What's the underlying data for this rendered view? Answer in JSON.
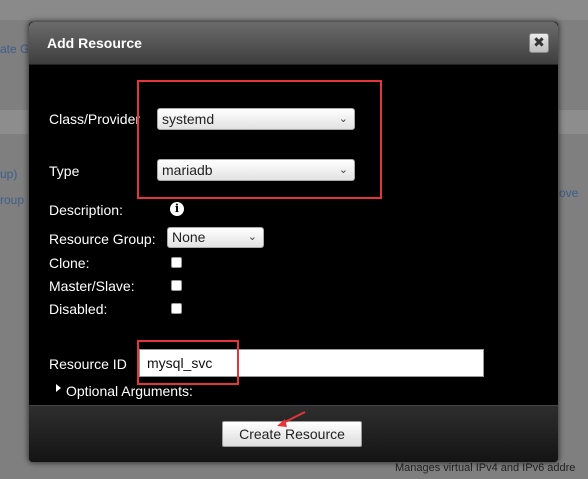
{
  "background": {
    "left_fragments": [
      "ate G",
      "up)",
      "roup"
    ],
    "right_fragment": "ove",
    "bottom_right_text": "Manages virtual IPv4 and IPv6 addre"
  },
  "dialog": {
    "title": "Add Resource",
    "close_glyph": "✖",
    "class_provider": {
      "label": "Class/Provider",
      "value": "systemd"
    },
    "type": {
      "label": "Type",
      "value": "mariadb"
    },
    "description": {
      "label": "Description:",
      "icon": "info-icon"
    },
    "resource_group": {
      "label": "Resource Group:",
      "value": "None"
    },
    "clone": {
      "label": "Clone:",
      "checked": false
    },
    "master_slave": {
      "label": "Master/Slave:",
      "checked": false
    },
    "disabled": {
      "label": "Disabled:",
      "checked": false
    },
    "resource_id": {
      "label": "Resource ID",
      "value": "mysql_svc"
    },
    "optional_arguments": {
      "label": "Optional Arguments:"
    },
    "create_button": "Create Resource"
  },
  "colors": {
    "annotation": "#e4353a",
    "dialog_bg": "#000000",
    "link": "#3d5e8a"
  }
}
